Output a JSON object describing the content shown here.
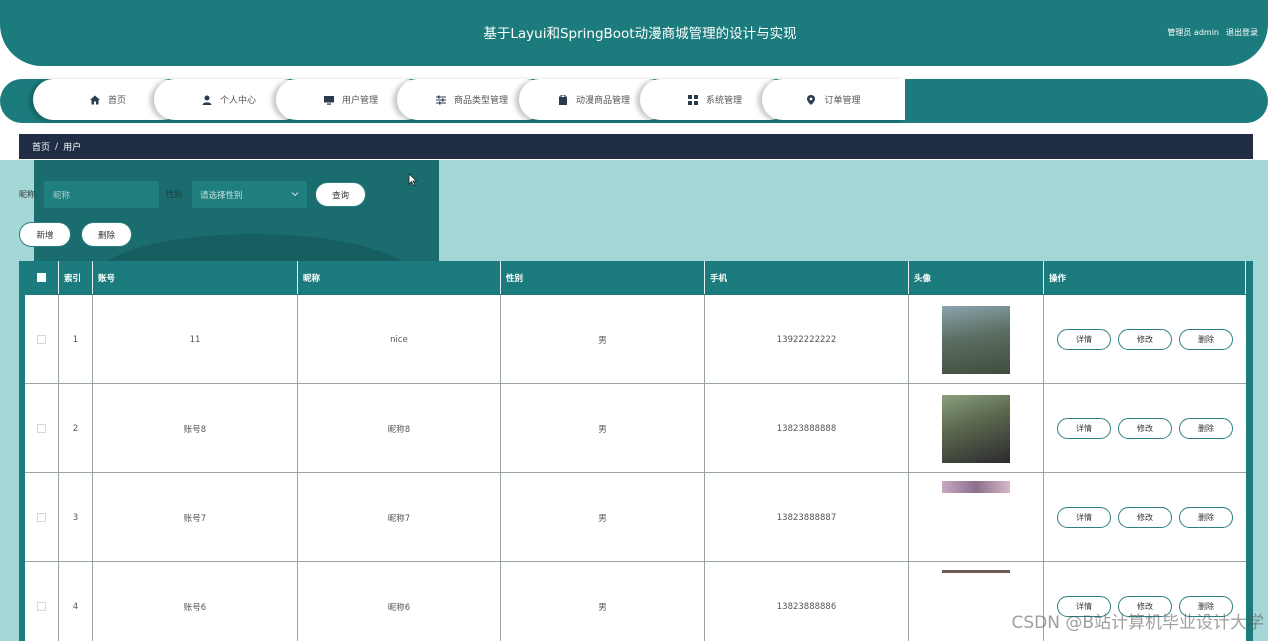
{
  "header": {
    "title": "基于Layui和SpringBoot动漫商城管理的设计与实现",
    "admin_label": "管理员 admin",
    "logout_label": "退出登录"
  },
  "nav": {
    "items": [
      {
        "label": "首页",
        "icon": "home-icon"
      },
      {
        "label": "个人中心",
        "icon": "user-icon"
      },
      {
        "label": "用户管理",
        "icon": "monitor-icon"
      },
      {
        "label": "商品类型管理",
        "icon": "sliders-icon"
      },
      {
        "label": "动漫商品管理",
        "icon": "clipboard-icon"
      },
      {
        "label": "系统管理",
        "icon": "grid-icon"
      },
      {
        "label": "订单管理",
        "icon": "location-pin-icon"
      }
    ]
  },
  "breadcrumb": {
    "home": "首页",
    "separator": "/",
    "current": "用户"
  },
  "search": {
    "nickname_label": "昵称",
    "nickname_placeholder": "昵称",
    "gender_label": "性别",
    "gender_placeholder": "请选择性别",
    "query_button": "查询",
    "add_button": "新增",
    "delete_button": "删除"
  },
  "table": {
    "columns": [
      "索引",
      "账号",
      "昵称",
      "性别",
      "手机",
      "头像",
      "操作"
    ],
    "action_labels": {
      "detail": "详情",
      "edit": "修改",
      "delete": "删除"
    },
    "rows": [
      {
        "index": "1",
        "account": "11",
        "nickname": "nice",
        "gender": "男",
        "phone": "13922222222"
      },
      {
        "index": "2",
        "account": "账号8",
        "nickname": "昵称8",
        "gender": "男",
        "phone": "13823888888"
      },
      {
        "index": "3",
        "account": "账号7",
        "nickname": "昵称7",
        "gender": "男",
        "phone": "13823888887"
      },
      {
        "index": "4",
        "account": "账号6",
        "nickname": "昵称6",
        "gender": "男",
        "phone": "13823888886"
      }
    ]
  },
  "watermark": "CSDN @B站计算机毕业设计大学",
  "colors": {
    "primary": "#1c7c7d",
    "breadcrumb_bg": "#212c45",
    "content_bg": "#a5d7d6",
    "search_panel": "#1b6c6e"
  }
}
